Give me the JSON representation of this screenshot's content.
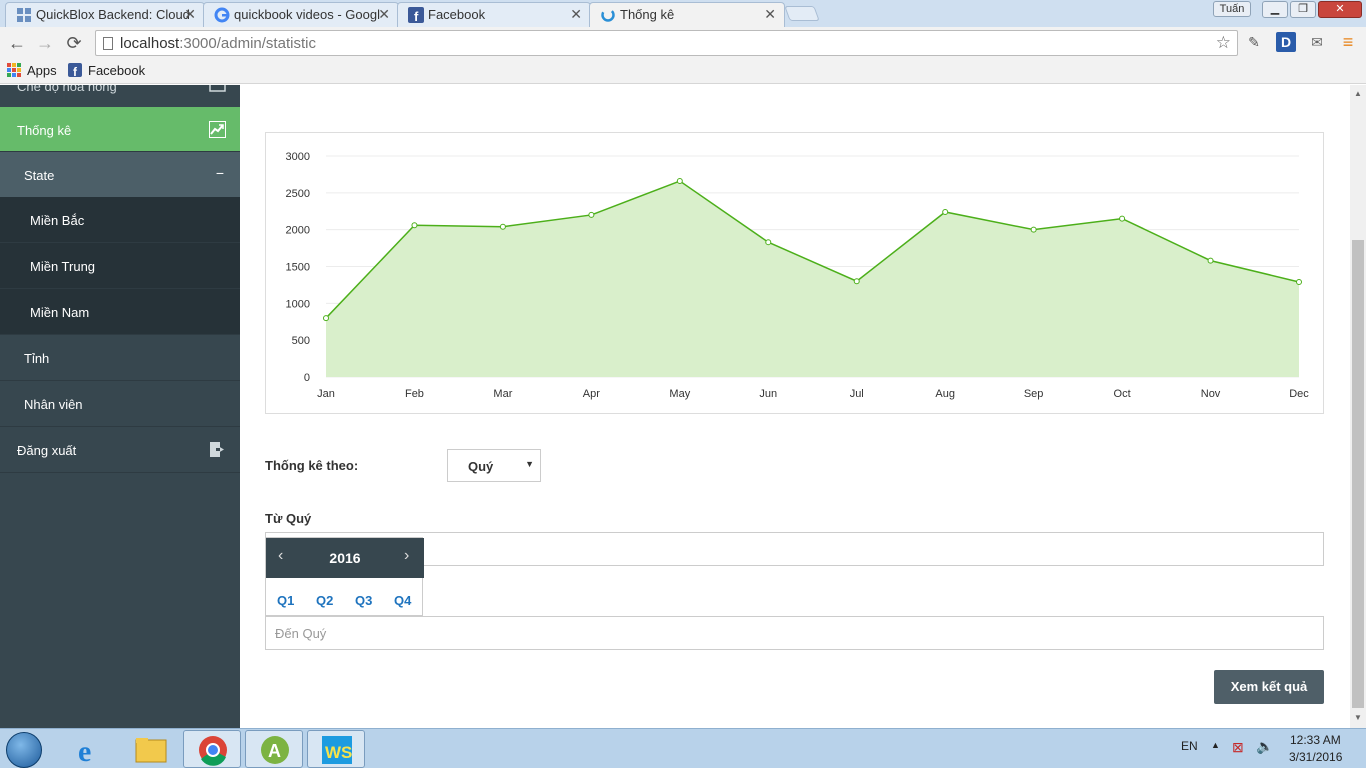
{
  "browser": {
    "tabs": [
      {
        "title": "QuickBlox Backend: Cloud",
        "icon": "quickblox-icon"
      },
      {
        "title": "quickbook videos - Googl",
        "icon": "google-icon"
      },
      {
        "title": "Facebook",
        "icon": "facebook-icon"
      },
      {
        "title": "Thống kê",
        "icon": "loading-icon"
      }
    ],
    "user_badge": "Tuấn",
    "url_host": "localhost",
    "url_rest": ":3000/admin/statistic",
    "bookmarks": [
      {
        "label": "Apps",
        "icon": "apps-grid-icon"
      },
      {
        "label": "Facebook",
        "icon": "facebook-icon"
      }
    ]
  },
  "sidebar": {
    "items": [
      {
        "label": "Chế độ hoa hồng"
      },
      {
        "label": "Thống kê"
      },
      {
        "label": "State",
        "toggle": "−"
      },
      {
        "label": "Miền Bắc"
      },
      {
        "label": "Miền Trung"
      },
      {
        "label": "Miền Nam"
      },
      {
        "label": "Tỉnh"
      },
      {
        "label": "Nhân viên"
      },
      {
        "label": "Đăng xuất"
      }
    ]
  },
  "chart_data": {
    "type": "area",
    "categories": [
      "Jan",
      "Feb",
      "Mar",
      "Apr",
      "May",
      "Jun",
      "Jul",
      "Aug",
      "Sep",
      "Oct",
      "Nov",
      "Dec"
    ],
    "values": [
      800,
      2060,
      2040,
      2200,
      2660,
      1830,
      1300,
      2240,
      2000,
      2150,
      1580,
      1290
    ],
    "ylim": [
      0,
      3000
    ],
    "yticks": [
      0,
      500,
      1000,
      1500,
      2000,
      2500,
      3000
    ],
    "grid": true,
    "colors": {
      "line": "#4caf1a",
      "fill": "#d9efcb"
    }
  },
  "form": {
    "stat_by_label": "Thống kê theo:",
    "stat_by_value": "Quý",
    "from_label": "Từ Quý",
    "to_placeholder": "Đến Quý",
    "picker_year": "2016",
    "quarters": [
      "Q1",
      "Q2",
      "Q3",
      "Q4"
    ],
    "submit_label": "Xem kết quả"
  },
  "taskbar": {
    "language": "EN",
    "time": "12:33 AM",
    "date": "3/31/2016"
  }
}
